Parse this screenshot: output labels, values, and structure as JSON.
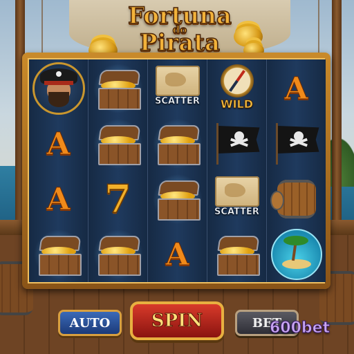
{
  "title": {
    "line1": "Fortuna",
    "line2": "do",
    "line3": "Pirata"
  },
  "reels": [
    [
      {
        "symbol": "pirate-captain"
      },
      {
        "symbol": "letter-a",
        "text": "A"
      },
      {
        "symbol": "letter-a",
        "text": "A"
      },
      {
        "symbol": "treasure-chest"
      }
    ],
    [
      {
        "symbol": "treasure-chest"
      },
      {
        "symbol": "treasure-chest"
      },
      {
        "symbol": "seven",
        "text": "7"
      },
      {
        "symbol": "treasure-chest"
      }
    ],
    [
      {
        "symbol": "scatter-map",
        "text": "SCATTER"
      },
      {
        "symbol": "treasure-chest"
      },
      {
        "symbol": "treasure-chest"
      },
      {
        "symbol": "letter-a",
        "text": "A"
      }
    ],
    [
      {
        "symbol": "wild-compass",
        "text": "WILD"
      },
      {
        "symbol": "jolly-roger-flag"
      },
      {
        "symbol": "scatter-map",
        "text": "SCATTER"
      },
      {
        "symbol": "treasure-chest"
      }
    ],
    [
      {
        "symbol": "letter-a",
        "text": "A"
      },
      {
        "symbol": "jolly-roger-flag"
      },
      {
        "symbol": "barrel"
      },
      {
        "symbol": "tropical-island"
      }
    ]
  ],
  "controls": {
    "auto_label": "AUTO",
    "spin_label": "SPIN",
    "bet_label": "BET"
  },
  "brand": "600bet",
  "colors": {
    "title_gold": "#f2b23a",
    "letter_orange": "#f08a1a",
    "spin_red": "#d83a2a",
    "auto_blue": "#3a6ab8",
    "brand_purple": "#c9a8f0"
  }
}
